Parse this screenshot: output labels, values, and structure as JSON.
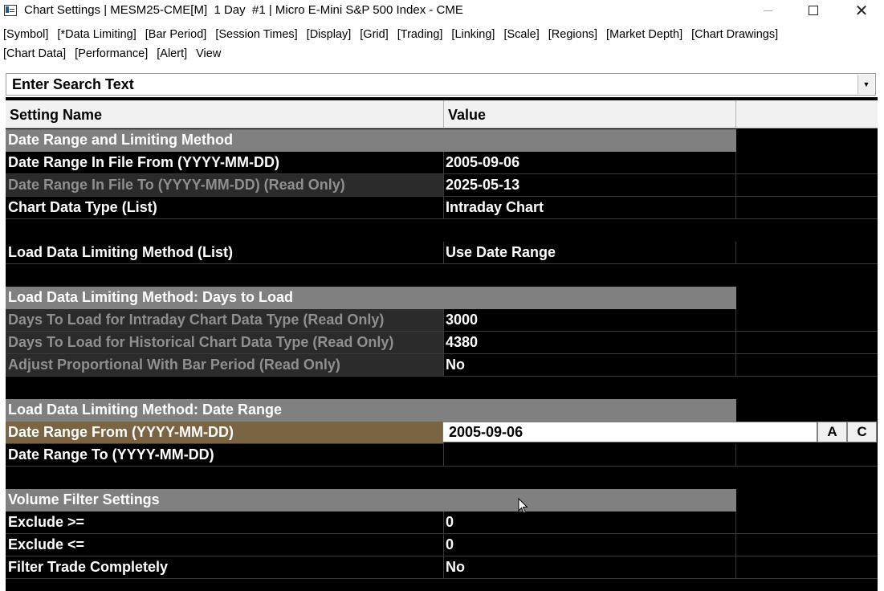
{
  "window": {
    "title": "Chart Settings | MESM25-CME[M]  1 Day  #1 | Micro E-Mini S&P 500 Index - CME",
    "close_glyph": "✕"
  },
  "menu": [
    [
      "[Symbol]",
      "[*Data Limiting]",
      "[Bar Period]",
      "[Session Times]",
      "[Display]",
      "[Grid]",
      "[Trading]",
      "[Linking]",
      "[Scale]",
      "[Regions]",
      "[Market Depth]",
      "[Chart Drawings]"
    ],
    [
      "[Chart Data]",
      "[Performance]",
      "[Alert]",
      "View"
    ]
  ],
  "search": {
    "placeholder": "Enter Search Text",
    "dropdown_glyph": "▼"
  },
  "table": {
    "headers": {
      "name": "Setting Name",
      "value": "Value"
    },
    "rows": [
      {
        "type": "group",
        "name": "Date Range and Limiting Method"
      },
      {
        "type": "row",
        "name": "Date Range In File From (YYYY-MM-DD)",
        "value": "2005-09-06"
      },
      {
        "type": "row",
        "name": "Date Range In File To (YYYY-MM-DD) (Read Only)",
        "value": "2025-05-13",
        "readonly": true
      },
      {
        "type": "row",
        "name": "Chart Data Type (List)",
        "value": "Intraday Chart"
      },
      {
        "type": "blank"
      },
      {
        "type": "row",
        "name": "Load Data Limiting Method (List)",
        "value": "Use Date Range"
      },
      {
        "type": "blank"
      },
      {
        "type": "group",
        "name": "Load Data Limiting Method: Days to Load"
      },
      {
        "type": "row",
        "name": "Days To Load for Intraday Chart Data Type (Read Only)",
        "value": "3000",
        "readonly": true
      },
      {
        "type": "row",
        "name": "Days To Load for Historical Chart Data Type (Read Only)",
        "value": "4380",
        "readonly": true
      },
      {
        "type": "row",
        "name": "Adjust Proportional With Bar Period (Read Only)",
        "value": "No",
        "readonly": true
      },
      {
        "type": "blank"
      },
      {
        "type": "group",
        "name": "Load Data Limiting Method: Date Range"
      },
      {
        "type": "edit",
        "name": "Date Range From (YYYY-MM-DD)",
        "value": "2005-09-06",
        "btn_a": "A",
        "btn_c": "C"
      },
      {
        "type": "row",
        "name": "Date Range To (YYYY-MM-DD)",
        "value": ""
      },
      {
        "type": "blank"
      },
      {
        "type": "group",
        "name": "Volume Filter Settings"
      },
      {
        "type": "row",
        "name": "Exclude >=",
        "value": "0"
      },
      {
        "type": "row",
        "name": "Exclude <=",
        "value": "0"
      },
      {
        "type": "row",
        "name": "Filter Trade Completely",
        "value": "No"
      }
    ]
  }
}
